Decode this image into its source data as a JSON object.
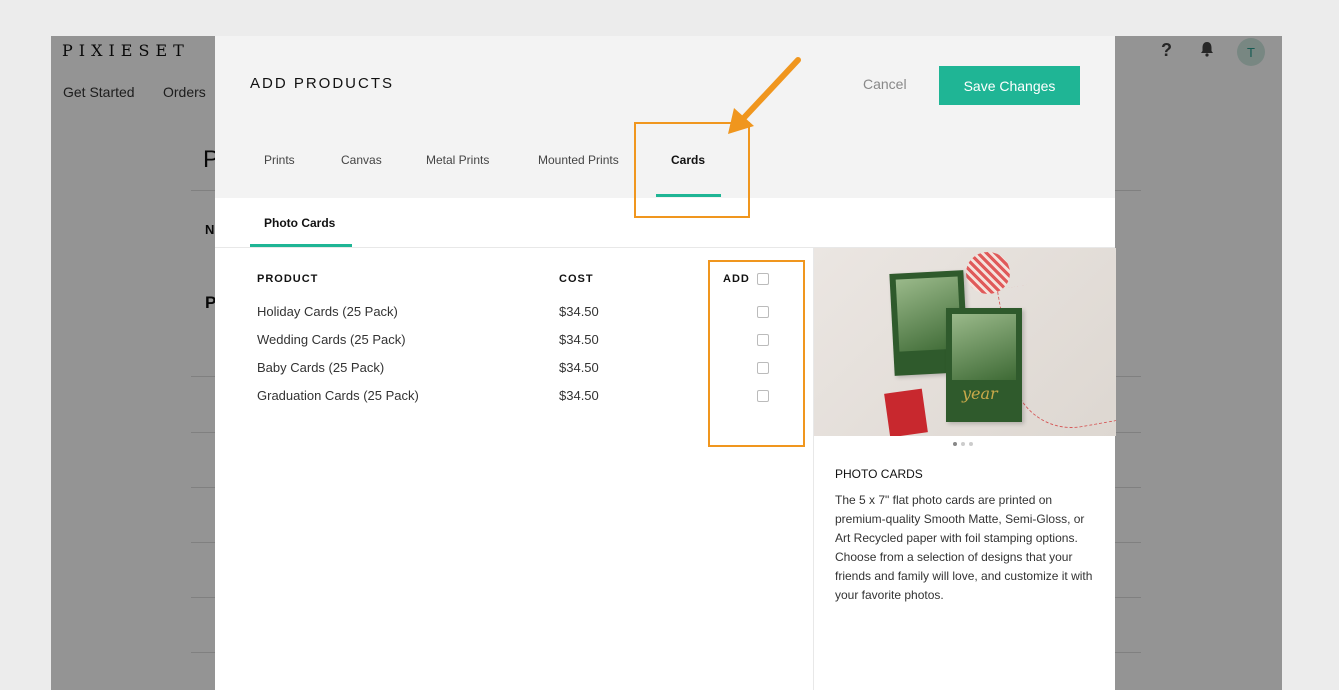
{
  "app": {
    "logo": "PIXIESET",
    "help_icon": "?",
    "avatar_initial": "T",
    "nav": [
      "Get Started",
      "Orders"
    ],
    "bg_fragments": [
      "P",
      "N",
      "P"
    ]
  },
  "modal": {
    "title": "ADD PRODUCTS",
    "cancel_label": "Cancel",
    "save_label": "Save Changes",
    "tabs": [
      {
        "label": "Prints"
      },
      {
        "label": "Canvas"
      },
      {
        "label": "Metal Prints"
      },
      {
        "label": "Mounted Prints"
      },
      {
        "label": "Cards",
        "active": true
      }
    ],
    "subtab": "Photo Cards",
    "table": {
      "headers": {
        "product": "PRODUCT",
        "cost": "COST",
        "add": "ADD"
      },
      "rows": [
        {
          "product": "Holiday Cards (25 Pack)",
          "cost": "$34.50"
        },
        {
          "product": "Wedding Cards (25 Pack)",
          "cost": "$34.50"
        },
        {
          "product": "Baby Cards (25 Pack)",
          "cost": "$34.50"
        },
        {
          "product": "Graduation Cards (25 Pack)",
          "cost": "$34.50"
        }
      ]
    },
    "panel": {
      "title": "PHOTO CARDS",
      "description": "The 5 x 7\" flat photo cards are printed on premium-quality Smooth Matte, Semi-Gloss, or Art Recycled paper with foil stamping options. Choose from a selection of designs that your friends and family will love, and customize it with your favorite photos.",
      "card_foil_text": "year",
      "carousel_slides": 3,
      "carousel_active": 1
    }
  },
  "colors": {
    "accent": "#1fb595",
    "annotation": "#f0961e"
  }
}
